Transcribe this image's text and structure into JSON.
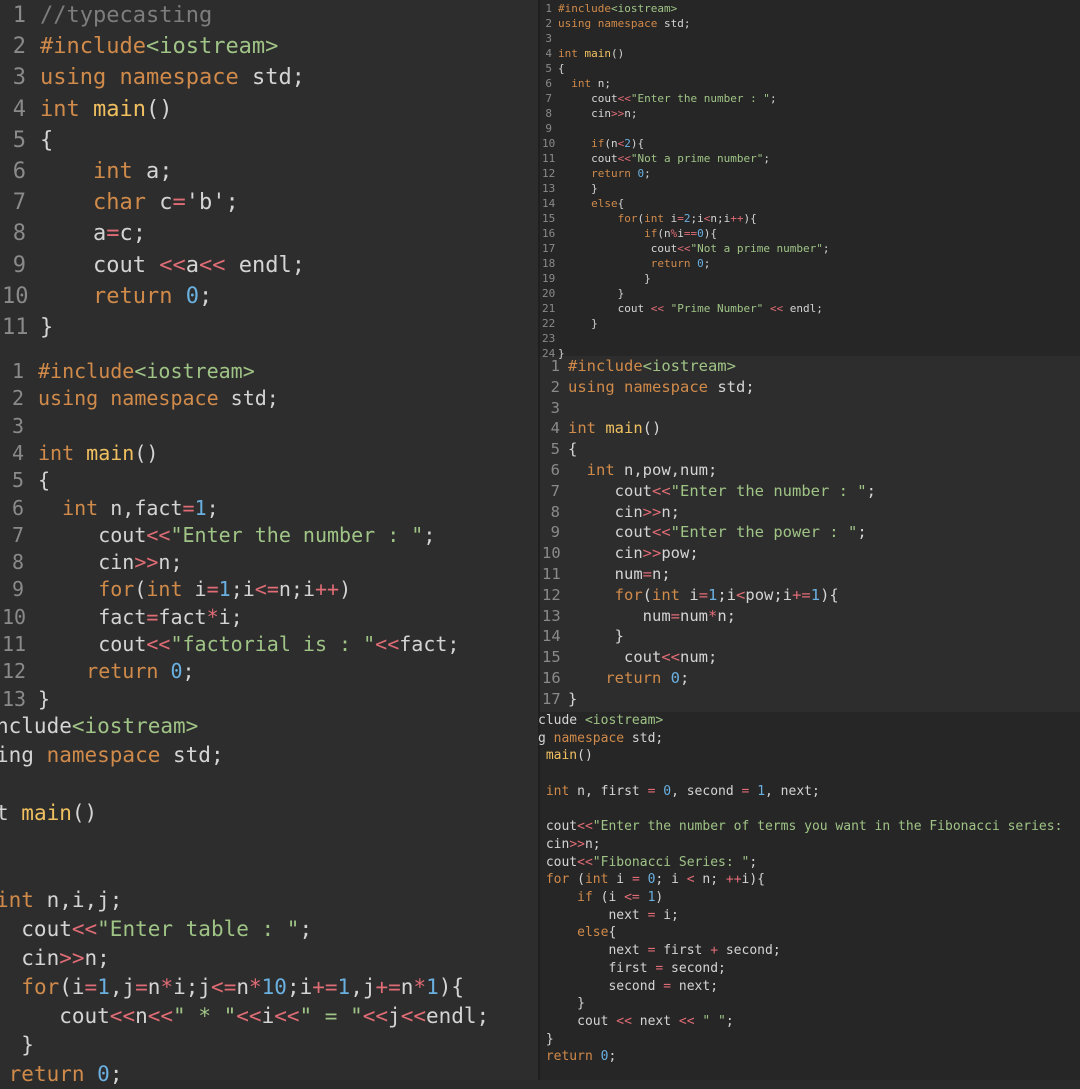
{
  "panels": [
    {
      "id": "typecasting",
      "lines": [
        {
          "n": "1",
          "t": "//typecasting"
        },
        {
          "n": "2",
          "t": "#include<iostream>"
        },
        {
          "n": "3",
          "t": "using namespace std;"
        },
        {
          "n": "4",
          "t": "int main()"
        },
        {
          "n": "5",
          "t": "{"
        },
        {
          "n": "6",
          "t": "    int a;"
        },
        {
          "n": "7",
          "t": "    char c='b';"
        },
        {
          "n": "8",
          "t": "    a=c;"
        },
        {
          "n": "9",
          "t": "    cout <<a<< endl;"
        },
        {
          "n": "10",
          "t": "    return 0;"
        },
        {
          "n": "11",
          "t": "}"
        }
      ]
    },
    {
      "id": "prime",
      "lines": [
        {
          "n": "1",
          "t": "#include<iostream>"
        },
        {
          "n": "2",
          "t": "using namespace std;"
        },
        {
          "n": "3",
          "t": ""
        },
        {
          "n": "4",
          "t": "int main()"
        },
        {
          "n": "5",
          "t": "{"
        },
        {
          "n": "6",
          "t": "  int n;"
        },
        {
          "n": "7",
          "t": "     cout<<\"Enter the number : \";"
        },
        {
          "n": "8",
          "t": "     cin>>n;"
        },
        {
          "n": "9",
          "t": ""
        },
        {
          "n": "10",
          "t": "     if(n<2){"
        },
        {
          "n": "11",
          "t": "     cout<<\"Not a prime number\";"
        },
        {
          "n": "12",
          "t": "     return 0;"
        },
        {
          "n": "13",
          "t": "     }"
        },
        {
          "n": "14",
          "t": "     else{"
        },
        {
          "n": "15",
          "t": "         for(int i=2;i<n;i++){"
        },
        {
          "n": "16",
          "t": "             if(n%i==0){"
        },
        {
          "n": "17",
          "t": "              cout<<\"Not a prime number\";"
        },
        {
          "n": "18",
          "t": "              return 0;"
        },
        {
          "n": "19",
          "t": "             }"
        },
        {
          "n": "20",
          "t": "         }"
        },
        {
          "n": "21",
          "t": "         cout << \"Prime Number\" << endl;"
        },
        {
          "n": "22",
          "t": "     }"
        },
        {
          "n": "23",
          "t": ""
        },
        {
          "n": "24",
          "t": "}"
        }
      ]
    },
    {
      "id": "factorial",
      "lines": [
        {
          "n": "1",
          "t": "#include<iostream>"
        },
        {
          "n": "2",
          "t": "using namespace std;"
        },
        {
          "n": "3",
          "t": ""
        },
        {
          "n": "4",
          "t": "int main()"
        },
        {
          "n": "5",
          "t": "{"
        },
        {
          "n": "6",
          "t": "  int n,fact=1;"
        },
        {
          "n": "7",
          "t": "     cout<<\"Enter the number : \";"
        },
        {
          "n": "8",
          "t": "     cin>>n;"
        },
        {
          "n": "9",
          "t": "     for(int i=1;i<=n;i++)"
        },
        {
          "n": "10",
          "t": "     fact=fact*i;"
        },
        {
          "n": "11",
          "t": "     cout<<\"factorial is : \"<<fact;"
        },
        {
          "n": "12",
          "t": "    return 0;"
        },
        {
          "n": "13",
          "t": "}"
        }
      ]
    },
    {
      "id": "power",
      "lines": [
        {
          "n": "1",
          "t": "#include<iostream>"
        },
        {
          "n": "2",
          "t": "using namespace std;"
        },
        {
          "n": "3",
          "t": ""
        },
        {
          "n": "4",
          "t": "int main()"
        },
        {
          "n": "5",
          "t": "{"
        },
        {
          "n": "6",
          "t": "  int n,pow,num;"
        },
        {
          "n": "7",
          "t": "     cout<<\"Enter the number : \";"
        },
        {
          "n": "8",
          "t": "     cin>>n;"
        },
        {
          "n": "9",
          "t": "     cout<<\"Enter the power : \";"
        },
        {
          "n": "10",
          "t": "     cin>>pow;"
        },
        {
          "n": "11",
          "t": "     num=n;"
        },
        {
          "n": "12",
          "t": "     for(int i=1;i<pow;i+=1){"
        },
        {
          "n": "13",
          "t": "        num=num*n;"
        },
        {
          "n": "14",
          "t": "     }"
        },
        {
          "n": "15",
          "t": "      cout<<num;"
        },
        {
          "n": "16",
          "t": "    return 0;"
        },
        {
          "n": "17",
          "t": "}"
        }
      ]
    },
    {
      "id": "table",
      "lines": [
        {
          "t": "nclude<iostream>"
        },
        {
          "t": "ing namespace std;"
        },
        {
          "t": ""
        },
        {
          "t": "t main()"
        },
        {
          "t": ""
        },
        {
          "t": ""
        },
        {
          "t": "int n,i,j;"
        },
        {
          "t": "  cout<<\"Enter table : \";"
        },
        {
          "t": "  cin>>n;"
        },
        {
          "t": "  for(i=1,j=n*i;j<=n*10;i+=1,j+=n*1){"
        },
        {
          "t": "     cout<<n<<\" * \"<<i<<\" = \"<<j<<endl;"
        },
        {
          "t": "  }"
        },
        {
          "t": " return 0;"
        }
      ]
    },
    {
      "id": "fibonacci",
      "lines": [
        {
          "t": "clude <iostream>"
        },
        {
          "t": "g namespace std;"
        },
        {
          "t": " main()"
        },
        {
          "t": ""
        },
        {
          "t": " int n, first = 0, second = 1, next;"
        },
        {
          "t": ""
        },
        {
          "t": " cout<<\"Enter the number of terms you want in the Fibonacci series: "
        },
        {
          "t": " cin>>n;"
        },
        {
          "t": " cout<<\"Fibonacci Series: \";"
        },
        {
          "t": " for (int i = 0; i < n; ++i){"
        },
        {
          "t": "     if (i <= 1)"
        },
        {
          "t": "         next = i;"
        },
        {
          "t": "     else{"
        },
        {
          "t": "         next = first + second;"
        },
        {
          "t": "         first = second;"
        },
        {
          "t": "         second = next;"
        },
        {
          "t": "     }"
        },
        {
          "t": "     cout << next << \" \";"
        },
        {
          "t": " }"
        },
        {
          "t": " return 0;"
        }
      ]
    }
  ]
}
